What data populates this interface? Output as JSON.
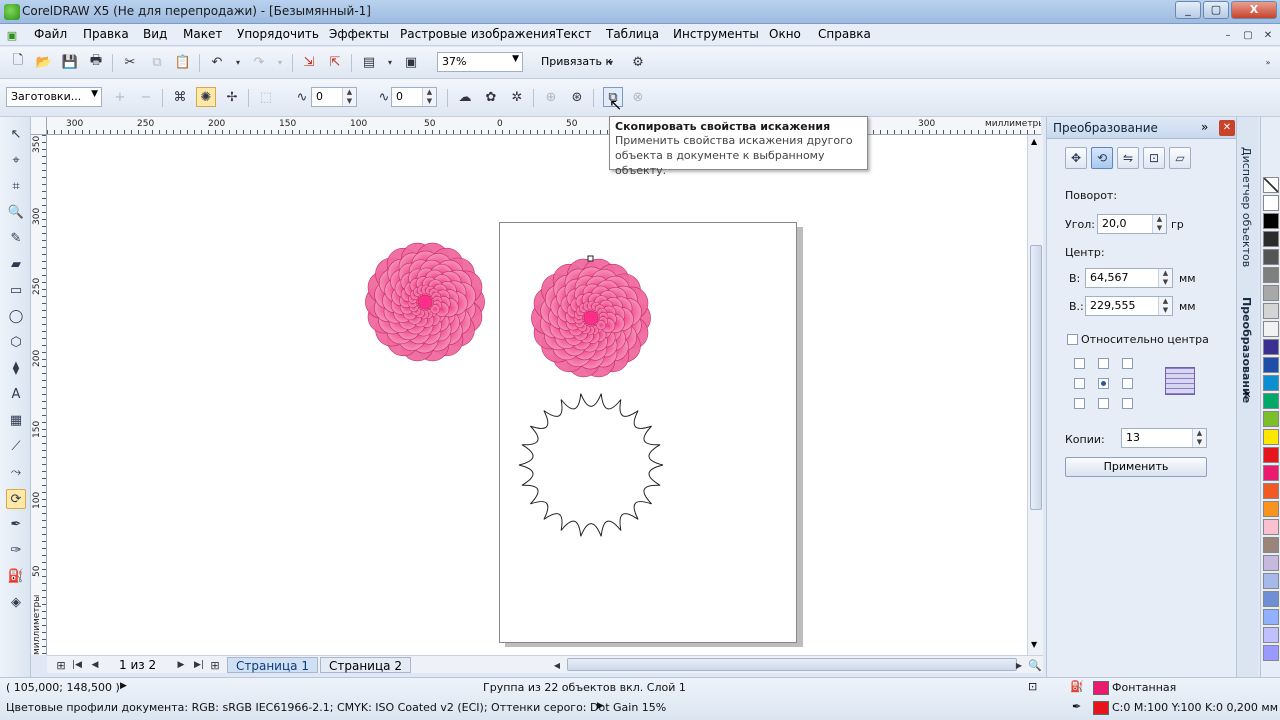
{
  "window": {
    "title": "CorelDRAW X5 (Не для перепродажи) - [Безымянный-1]",
    "minimize": "_",
    "maximize": "▢",
    "close": "X"
  },
  "menu": [
    "Файл",
    "Правка",
    "Вид",
    "Макет",
    "Упорядочить",
    "Эффекты",
    "Растровые изображения",
    "Текст",
    "Таблица",
    "Инструменты",
    "Окно",
    "Справка"
  ],
  "toolbar": {
    "zoom_value": "37%",
    "snap_label": "Привязать к"
  },
  "propertybar": {
    "presets_label": "Заготовки...",
    "amplitude": "0",
    "frequency": "0"
  },
  "tooltip": {
    "title": "Скопировать свойства искажения",
    "body_line1": "Применить свойства искажения другого",
    "body_line2": "объекта в документе к выбранному объекту."
  },
  "ruler": {
    "units": "миллиметры",
    "h_ticks": [
      "300",
      "250",
      "200",
      "150",
      "100",
      "50",
      "0",
      "50",
      "300"
    ],
    "v_ticks": [
      "350",
      "300",
      "250",
      "200",
      "150",
      "100",
      "50"
    ],
    "v_units": "миллиметры"
  },
  "docker": {
    "title": "Преобразование",
    "rotation_label": "Поворот:",
    "angle_label": "Угол:",
    "angle_value": "20,0",
    "angle_unit": "гр",
    "center_label": "Центр:",
    "h_label": "В:",
    "h_value": "64,567",
    "v_label": "В.:",
    "v_value": "229,555",
    "unit_mm": "мм",
    "relative_label": "Относительно центра",
    "copies_label": "Копии:",
    "copies_value": "13",
    "apply_label": "Применить"
  },
  "sidetabs": [
    "Диспетчер объектов",
    "Преобразование"
  ],
  "pages": {
    "counter": "1 из 2",
    "tabs": [
      "Страница 1",
      "Страница 2"
    ]
  },
  "status": {
    "coords": "( 105,000; 148,500 )",
    "selection": "Группа из 22 объектов вкл. Слой 1",
    "fill_label": "Фонтанная",
    "outline_label": "C:0 M:100 Y:100 K:0  0,200 мм",
    "profiles": "Цветовые профили документа: RGB: sRGB IEC61966-2.1; CMYK: ISO Coated v2 (ECI); Оттенки серого: Dot Gain 15%"
  },
  "colors": {
    "flower_pink": "#f06aa0",
    "flower_edge": "#c2275f",
    "flower_center": "#ff2e8a",
    "fill_chip": "#ec1a6e",
    "outline_chip": "#e8141c"
  },
  "palette": [
    "#ffffff",
    "#000000",
    "#2b2b2b",
    "#555555",
    "#7f7f7f",
    "#a8a8a8",
    "#d4d4d4",
    "#f2f2f2",
    "#3c2f8f",
    "#1f4ea8",
    "#0d8ed1",
    "#00a86b",
    "#7dbf2a",
    "#ffe600",
    "#e8141c",
    "#ec1a6e",
    "#f15a24",
    "#f7931e",
    "#f9c1cf",
    "#9b8579",
    "#c7b8e0",
    "#a7b9e8",
    "#6e8fd4",
    "#8fb1ff",
    "#c0c0ff",
    "#9999ff"
  ]
}
